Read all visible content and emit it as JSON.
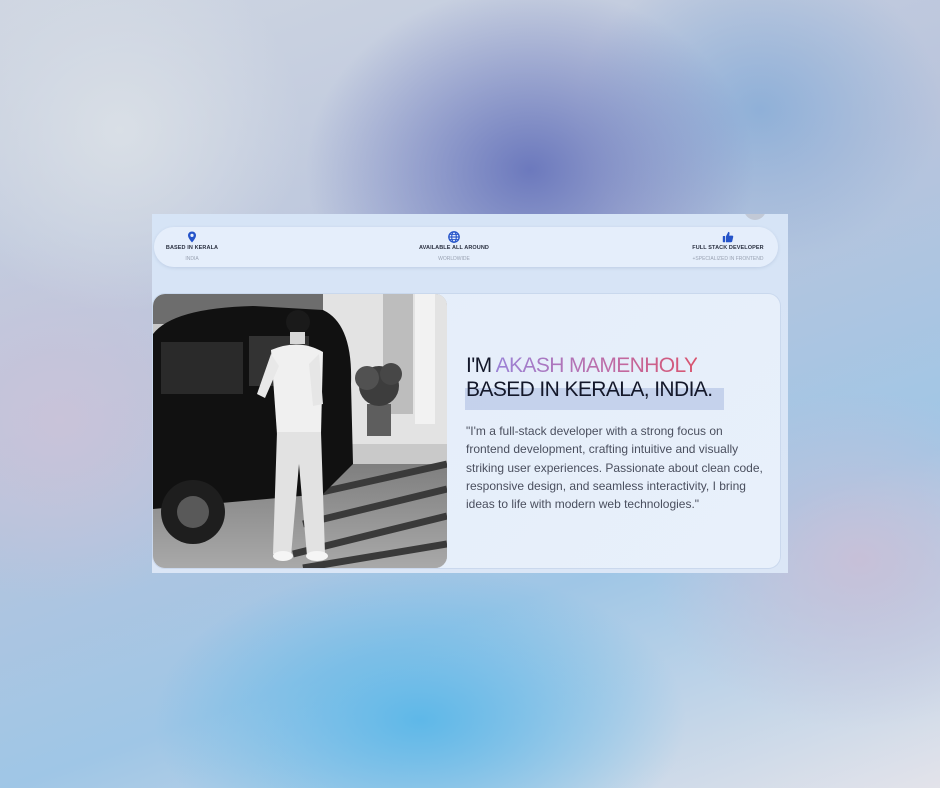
{
  "info_bar": {
    "location": {
      "icon": "location-pin-icon",
      "title": "BASED IN KERALA",
      "subtitle": "INDIA"
    },
    "availability": {
      "icon": "globe-icon",
      "title": "AVAILABLE ALL AROUND",
      "subtitle": "WORLDWIDE"
    },
    "role": {
      "icon": "thumbs-up-icon",
      "title": "FULL STACK DEVELOPER",
      "subtitle": "+SPECIALIZED IN FRONTEND"
    }
  },
  "hero": {
    "prefix": "I'M ",
    "name": "AKASH MAMENHOLY",
    "line2": "BASED IN KERALA, INDIA.",
    "bio": "\"I'm a full-stack developer with a strong focus on frontend development, crafting intuitive and visually striking user experiences. Passionate about clean code, responsive design, and seamless interactivity, I bring ideas to life with modern web technologies.\""
  },
  "colors": {
    "icon_blue": "#2453c9",
    "name_gradient_start": "#9b82d6",
    "name_gradient_end": "#d9546e",
    "heading": "#14182a"
  }
}
